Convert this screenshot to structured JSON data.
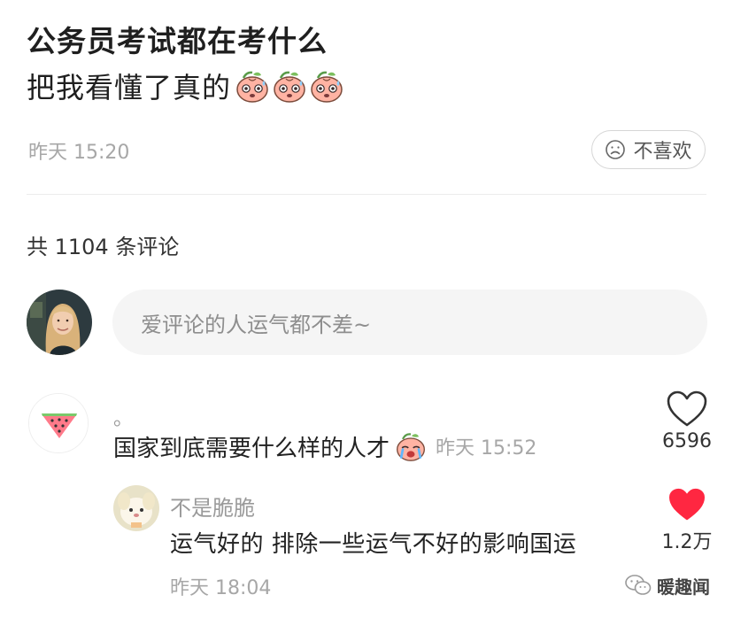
{
  "post": {
    "title": "公务员考试都在考什么",
    "body": "把我看懂了真的",
    "body_emoji_icon": "sweating-peach-emoji-icon",
    "time": "昨天 15:20",
    "dislike_icon": "frown-face-icon",
    "dislike_label": "不喜欢"
  },
  "comments_section": {
    "count_label": "共 1104 条评论",
    "input_placeholder": "爱评论的人运气都不差~"
  },
  "comments": [
    {
      "avatar_icon": "watermelon-avatar",
      "username": "。",
      "text": "国家到底需要什么样的人才",
      "emoji_icon": "crying-peach-emoji-icon",
      "time": "昨天 15:52",
      "like_icon": "heart-outline-icon",
      "likes": "6596",
      "liked": false
    },
    {
      "avatar_icon": "cartoon-dog-avatar",
      "username": "不是脆脆",
      "text": "运气好的 排除一些运气不好的影响国运",
      "time": "昨天 18:04",
      "like_icon": "heart-filled-icon",
      "likes": "1.2万",
      "liked": true
    }
  ],
  "watermark": {
    "icon": "wechat-icon",
    "text": "暖趣闻"
  },
  "colors": {
    "liked_heart": "#ff2741",
    "meta_gray": "#a7a7a7",
    "input_bg": "#f5f5f5"
  }
}
